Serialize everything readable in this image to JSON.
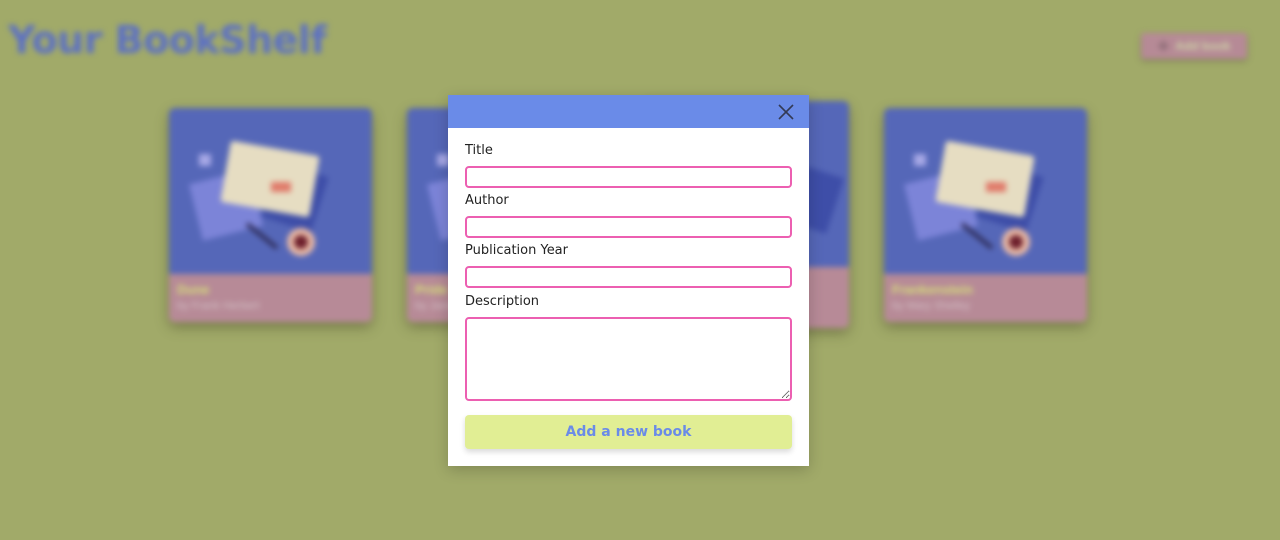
{
  "page": {
    "title": "Your BookShelf",
    "add_button_label": "Add book",
    "add_button_icon": "plus-icon"
  },
  "books": [
    {
      "title": "Dune",
      "author": "by Frank Herbert"
    },
    {
      "title": "Pride",
      "author": "by Jane"
    },
    {
      "title": "",
      "author": ""
    },
    {
      "title": "Frankenstein",
      "author": "by Mary Shelley"
    }
  ],
  "modal": {
    "close_icon": "close-icon",
    "fields": {
      "title": {
        "label": "Title",
        "value": "",
        "placeholder": ""
      },
      "author": {
        "label": "Author",
        "value": "",
        "placeholder": ""
      },
      "year": {
        "label": "Publication Year",
        "value": "",
        "placeholder": ""
      },
      "description": {
        "label": "Description",
        "value": "",
        "placeholder": ""
      }
    },
    "submit_label": "Add a new book"
  },
  "colors": {
    "backdrop": "#a1aa69",
    "modal_header": "#6a8be8",
    "input_border": "#ec5fb1",
    "submit_bg": "#e1ee94",
    "submit_text": "#6a8be8",
    "page_title": "#5d71c2"
  }
}
